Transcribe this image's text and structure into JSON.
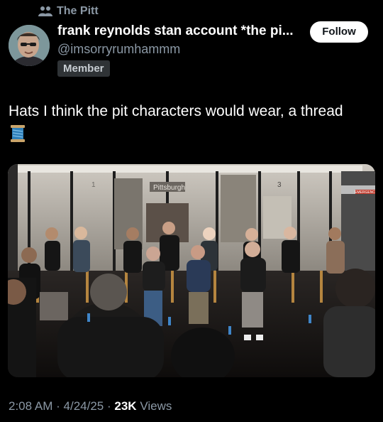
{
  "post": {
    "community": "The Pitt",
    "author_name": "frank reynolds stan account *the pi...",
    "author_handle": "@imsorryrumhammm",
    "member_badge": "Member",
    "follow_label": "Follow",
    "text": "Hats I think the pit characters would wear, a thread",
    "text_emoji": "spool-of-thread",
    "meta": {
      "time": "2:08 AM",
      "date": "4/24/25",
      "views_count": "23K",
      "views_label": "Views",
      "separator": "·"
    }
  },
  "photo": {
    "signage": [
      "Pittsburgh",
      "1",
      "3",
      "EMERGENCY"
    ]
  },
  "colors": {
    "background": "#000000",
    "secondary_text": "#8b98a5",
    "follow_button_bg": "#ffffff",
    "badge_bg": "#2f3336"
  }
}
